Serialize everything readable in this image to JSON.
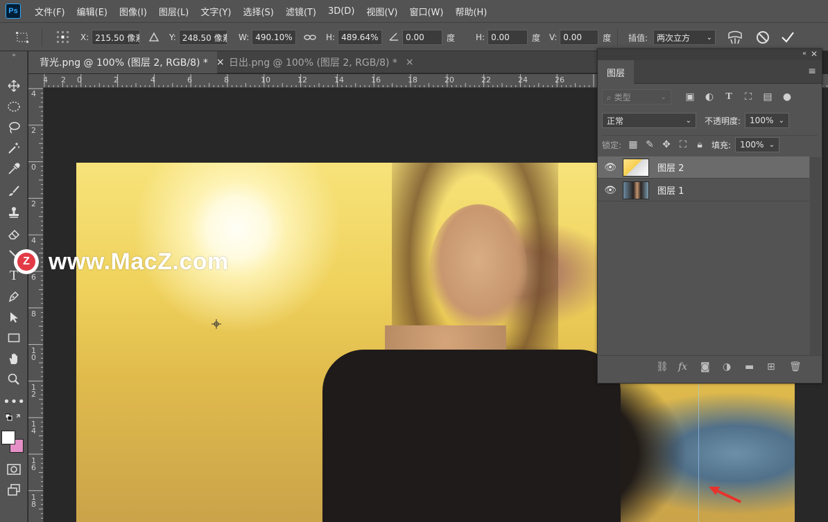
{
  "menu": {
    "app_logo": "Ps",
    "items": [
      "文件(F)",
      "编辑(E)",
      "图像(I)",
      "图层(L)",
      "文字(Y)",
      "选择(S)",
      "滤镜(T)",
      "3D(D)",
      "视图(V)",
      "窗口(W)",
      "帮助(H)"
    ]
  },
  "options": {
    "x_label": "X:",
    "x_value": "215.50 像素",
    "y_label": "Y:",
    "y_value": "248.50 像素",
    "w_label": "W:",
    "w_value": "490.10%",
    "h_label": "H:",
    "h_value": "489.64%",
    "angle_value": "0.00",
    "angle_unit": "度",
    "skew_h_label": "H:",
    "skew_h_value": "0.00",
    "skew_h_unit": "度",
    "skew_v_label": "V:",
    "skew_v_value": "0.00",
    "skew_v_unit": "度",
    "interp_label": "插值:",
    "interp_value": "两次立方"
  },
  "tabs": [
    {
      "label": "背光.png @ 100% (图层 2, RGB/8) *",
      "close": "×"
    },
    {
      "label": "日出.png @ 100% (图层 2, RGB/8) *",
      "close": "×"
    }
  ],
  "ruler": {
    "top_labels": [
      "4",
      "2",
      "0",
      "2",
      "4",
      "6",
      "8",
      "10",
      "12",
      "14",
      "16",
      "18",
      "20",
      "22",
      "24",
      "26"
    ],
    "left_labels": [
      "4",
      "2",
      "0",
      "2",
      "4",
      "6",
      "8",
      "10",
      "12",
      "14",
      "16",
      "18"
    ]
  },
  "watermark": {
    "logo_letter": "Z",
    "text": "www.MacZ.com"
  },
  "layers_panel": {
    "tab_label": "图层",
    "filter_placeholder": "类型",
    "blend_mode": "正常",
    "opacity_label": "不透明度:",
    "opacity_value": "100%",
    "lock_label": "锁定:",
    "fill_label": "填充:",
    "fill_value": "100%",
    "layers": [
      {
        "name": "图层 2",
        "selected": true
      },
      {
        "name": "图层 1",
        "selected": false
      }
    ],
    "footer_icons": [
      "link-icon",
      "fx-icon",
      "mask-icon",
      "adjustment-icon",
      "folder-icon",
      "new-layer-icon",
      "trash-icon"
    ]
  },
  "colors": {
    "foreground": "#ffffff",
    "background": "#e48fc6",
    "guide": "#9ad0ff",
    "arrow": "#e8322c"
  }
}
